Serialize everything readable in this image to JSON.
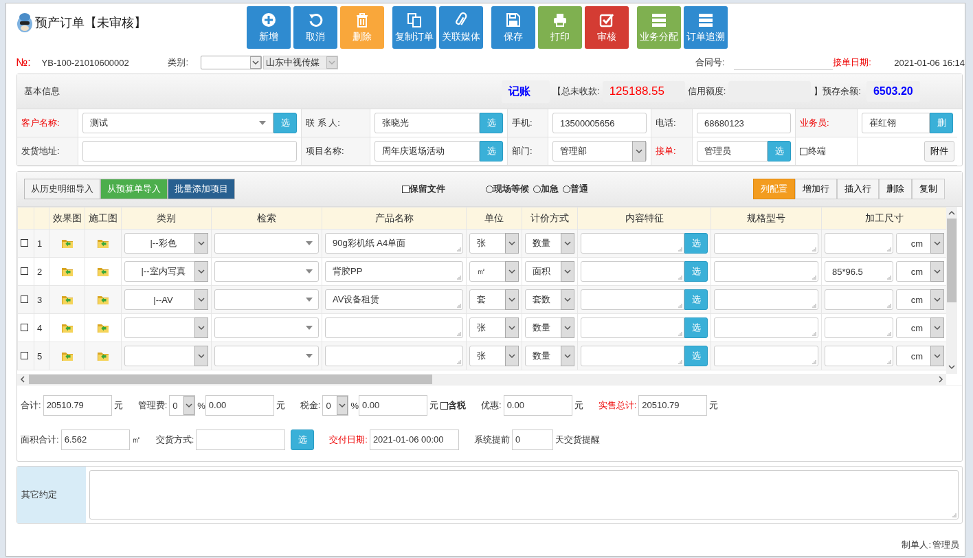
{
  "header": {
    "title": "预产订单【未审核】",
    "toolbar": [
      [
        {
          "label": "新增",
          "color": "#2f8bd0",
          "kind": "plus"
        },
        {
          "label": "取消",
          "color": "#2f8bd0",
          "kind": "undo"
        },
        {
          "label": "删除",
          "color": "#f9a73b",
          "kind": "trash"
        }
      ],
      [
        {
          "label": "复制订单",
          "color": "#2f8bd0",
          "kind": "copy"
        },
        {
          "label": "关联媒体",
          "color": "#2f8bd0",
          "kind": "clip"
        }
      ],
      [
        {
          "label": "保存",
          "color": "#2f8bd0",
          "kind": "save"
        },
        {
          "label": "打印",
          "color": "#7fb050",
          "kind": "print"
        },
        {
          "label": "审核",
          "color": "#d43c33",
          "kind": "check"
        }
      ],
      [
        {
          "label": "业务分配",
          "color": "#7fb050",
          "kind": "list"
        },
        {
          "label": "订单追溯",
          "color": "#2f8bd0",
          "kind": "list"
        }
      ]
    ]
  },
  "order": {
    "no_label": "№:",
    "no": "YB-100-21010600002",
    "category_label": "类别:",
    "company": "山东中视传媒",
    "contract_label": "合同号:",
    "date_label": "接单日期:",
    "date": "2021-01-06 16:14"
  },
  "basic_info": {
    "title": "基本信息",
    "summary": [
      {
        "kind": "badge",
        "text": "记账",
        "color": "#0000ff"
      },
      {
        "kind": "label",
        "text": "【总未收款:"
      },
      {
        "kind": "value",
        "text": "125188.55",
        "color": "#ff0000"
      },
      {
        "kind": "label",
        "text": "信用额度:"
      },
      {
        "kind": "value"
      },
      {
        "kind": "label",
        "text": "】预存余额:"
      },
      {
        "kind": "badge",
        "text": "6503.20",
        "color": "#0000ff"
      }
    ],
    "rows": [
      [
        {
          "kind": "label",
          "text": "客户名称:",
          "required": true
        },
        {
          "kind": "combo",
          "value": "测试",
          "button": "选"
        },
        {
          "kind": "label",
          "text": "联 系 人:",
          "required": false
        },
        {
          "kind": "text",
          "value": "张晓光",
          "button": "选"
        },
        {
          "kind": "label",
          "text": "手机:",
          "required": false
        },
        {
          "kind": "text",
          "value": "13500005656"
        },
        {
          "kind": "label",
          "text": "电话:",
          "required": false
        },
        {
          "kind": "text",
          "value": "68680123"
        },
        {
          "kind": "label",
          "text": "业务员:",
          "required": true
        },
        {
          "kind": "text",
          "value": "崔红翎",
          "button": "删"
        }
      ],
      [
        {
          "kind": "label",
          "text": "发货地址:",
          "required": false
        },
        {
          "kind": "text"
        },
        {
          "kind": "label",
          "text": "项目名称:",
          "required": false
        },
        {
          "kind": "text",
          "value": "周年庆返场活动",
          "button": "选"
        },
        {
          "kind": "label",
          "text": "部门:",
          "required": false
        },
        {
          "kind": "select",
          "value": "管理部"
        },
        {
          "kind": "label",
          "text": "接单:",
          "required": true
        },
        {
          "kind": "text",
          "value": "管理员",
          "button": "选"
        },
        {
          "kind": "check",
          "label": "终端",
          "checked": false
        },
        {
          "kind": "button",
          "label": "附件"
        }
      ]
    ]
  },
  "details": {
    "imports": [
      {
        "label": "从历史明细导入",
        "color": "#f2f2f2"
      },
      {
        "label": "从预算单导入",
        "color": "#4cae4c"
      },
      {
        "label": "批量添加项目",
        "color": "#286090"
      }
    ],
    "keep_file": {
      "label": "保留文件",
      "checked": false
    },
    "priority": [
      {
        "label": "现场等候",
        "selected": false
      },
      {
        "label": "加急",
        "selected": false
      },
      {
        "label": "普通",
        "selected": false
      }
    ],
    "actions": [
      {
        "label": "列配置",
        "selected": true
      },
      {
        "label": "增加行",
        "selected": false
      },
      {
        "label": "插入行",
        "selected": false
      },
      {
        "label": "删除",
        "selected": false
      },
      {
        "label": "复制",
        "selected": false
      }
    ],
    "columns": [
      "效果图",
      "施工图",
      "类别",
      "检索",
      "产品名称",
      "单位",
      "计价方式",
      "内容特征",
      "规格型号",
      "加工尺寸"
    ],
    "rows": [
      {
        "checked": false,
        "no": "1",
        "category": "|--彩色",
        "product": "90g彩机纸 A4单面",
        "unit": "张",
        "pricing": "数量",
        "content_button": "选",
        "size_unit": "cm"
      },
      {
        "checked": false,
        "no": "2",
        "category": "|--室内写真",
        "product": "背胶PP",
        "unit": "㎡",
        "pricing": "面积",
        "content_button": "选",
        "size": "85*96.5",
        "size_unit": "cm"
      },
      {
        "checked": false,
        "no": "3",
        "category": "|--AV",
        "product": "AV设备租赁",
        "unit": "套",
        "pricing": "套数",
        "content_button": "选",
        "size_unit": "cm"
      },
      {
        "checked": false,
        "no": "4",
        "unit": "张",
        "pricing": "数量",
        "content_button": "选",
        "size_unit": "cm"
      },
      {
        "checked": false,
        "no": "5",
        "unit": "张",
        "pricing": "数量",
        "content_button": "选",
        "size_unit": "cm"
      }
    ]
  },
  "totals": [
    [
      {
        "kind": "label",
        "text": "合计:"
      },
      {
        "kind": "input",
        "value": "20510.79"
      },
      {
        "kind": "unit",
        "text": "元"
      },
      {
        "kind": "label",
        "text": "管理费:"
      },
      {
        "kind": "select",
        "value": "0"
      },
      {
        "kind": "unit",
        "text": "%"
      },
      {
        "kind": "input",
        "value": "0.00"
      },
      {
        "kind": "unit",
        "text": "元"
      },
      {
        "kind": "label",
        "text": "税金:"
      },
      {
        "kind": "select",
        "value": "0"
      },
      {
        "kind": "unit",
        "text": "%"
      },
      {
        "kind": "input",
        "value": "0.00"
      },
      {
        "kind": "unit",
        "text": "元"
      },
      {
        "kind": "check",
        "text": "含税",
        "checked": false
      },
      {
        "kind": "label",
        "text": "优惠:"
      },
      {
        "kind": "input",
        "value": "0.00"
      },
      {
        "kind": "unit",
        "text": "元"
      },
      {
        "kind": "label",
        "text": "实售总计:",
        "required": true
      },
      {
        "kind": "input",
        "value": "20510.79"
      },
      {
        "kind": "unit",
        "text": "元"
      }
    ],
    [
      {
        "kind": "label",
        "text": "面积合计:"
      },
      {
        "kind": "input",
        "value": "6.562"
      },
      {
        "kind": "unit",
        "text": "㎡"
      },
      {
        "kind": "label",
        "text": "交货方式:"
      },
      {
        "kind": "input"
      },
      {
        "kind": "button",
        "text": "选"
      },
      {
        "kind": "label",
        "text": "交付日期:",
        "required": true
      },
      {
        "kind": "input",
        "value": "2021-01-06 00:00"
      },
      {
        "kind": "label",
        "text": "系统提前"
      },
      {
        "kind": "small",
        "value": "0"
      },
      {
        "kind": "unit",
        "text": "天交货提醒"
      }
    ]
  ],
  "other": {
    "label": "其它约定"
  },
  "footer": {
    "creator_label": "制单人:",
    "creator": "管理员"
  }
}
